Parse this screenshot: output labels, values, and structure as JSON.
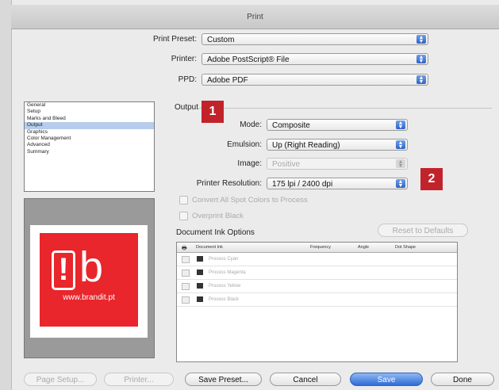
{
  "window": {
    "title": "Print"
  },
  "top": {
    "preset_label": "Print Preset:",
    "preset_value": "Custom",
    "printer_label": "Printer:",
    "printer_value": "Adobe PostScript® File",
    "ppd_label": "PPD:",
    "ppd_value": "Adobe PDF"
  },
  "sidebar": {
    "items": [
      "General",
      "Setup",
      "Marks and Bleed",
      "Output",
      "Graphics",
      "Color Management",
      "Advanced",
      "Summary"
    ],
    "selected": "Output"
  },
  "preview": {
    "url_text": "www.brandit.pt"
  },
  "output": {
    "section_title": "Output",
    "mode_label": "Mode:",
    "mode_value": "Composite",
    "emulsion_label": "Emulsion:",
    "emulsion_value": "Up (Right Reading)",
    "image_label": "Image:",
    "image_value": "Positive",
    "resolution_label": "Printer Resolution:",
    "resolution_value": "175 lpi / 2400 dpi",
    "convert_label": "Convert All Spot Colors to Process",
    "overprint_label": "Overprint Black"
  },
  "inks": {
    "title": "Document Ink Options",
    "reset_label": "Reset to Defaults",
    "columns": [
      "Document Ink",
      "Frequency",
      "Angle",
      "Dot Shape"
    ],
    "rows": [
      "Process Cyan",
      "Process Magenta",
      "Process Yellow",
      "Process Black"
    ]
  },
  "buttons": {
    "page_setup": "Page Setup...",
    "printer": "Printer...",
    "save_preset": "Save Preset...",
    "cancel": "Cancel",
    "save": "Save",
    "done": "Done"
  },
  "badges": {
    "one": "1",
    "two": "2"
  },
  "colors": {
    "accent": "#2f6bd6",
    "badge": "#c1232b",
    "brand_red": "#e8262b"
  }
}
